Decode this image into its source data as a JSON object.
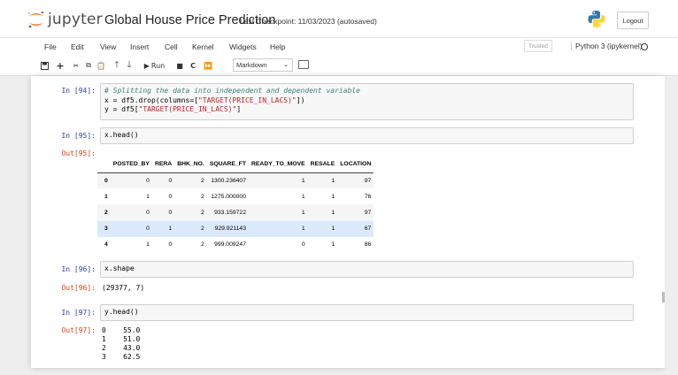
{
  "header": {
    "logo_text": "jupyter",
    "notebook_title": "Global House Price Prediction",
    "checkpoint": "Last Checkpoint: 11/03/2023  (autosaved)",
    "logout_label": "Logout"
  },
  "menubar": {
    "items": [
      "File",
      "Edit",
      "View",
      "Insert",
      "Cell",
      "Kernel",
      "Widgets",
      "Help"
    ],
    "trusted_label": "Trusted",
    "kernel_name": "Python 3 (ipykernel)"
  },
  "toolbar": {
    "run_label": "Run",
    "cell_type": "Markdown"
  },
  "cells": {
    "c94": {
      "prompt": "In [94]:",
      "comment": "# Splitting the data into independent and dependent variable",
      "line2_pre": "x = df5.drop(columns=[",
      "line2_str": "\"TARGET(PRICE_IN_LACS)\"",
      "line2_post": "])",
      "line3_pre": "y = df5[",
      "line3_str": "\"TARGET(PRICE_IN_LACS)\"",
      "line3_post": "]"
    },
    "c95": {
      "prompt": "In [95]:",
      "code": "x.head()",
      "out_prompt": "Out[95]:"
    },
    "c96": {
      "prompt": "In [96]:",
      "code": "x.shape",
      "out_prompt": "Out[96]:",
      "output": "(29377, 7)"
    },
    "c97": {
      "prompt": "In [97]:",
      "code": "y.head()",
      "out_prompt": "Out[97]:",
      "output_lines": [
        "0    55.0",
        "1    51.0",
        "2    43.0",
        "3    62.5"
      ]
    }
  },
  "dataframe": {
    "columns": [
      "",
      "POSTED_BY",
      "RERA",
      "BHK_NO.",
      "SQUARE_FT",
      "READY_TO_MOVE",
      "RESALE",
      "LOCATION"
    ],
    "rows": [
      [
        "0",
        "0",
        "0",
        "2",
        "1300.236407",
        "1",
        "1",
        "97"
      ],
      [
        "1",
        "1",
        "0",
        "2",
        "1275.000000",
        "1",
        "1",
        "76"
      ],
      [
        "2",
        "0",
        "0",
        "2",
        "933.159722",
        "1",
        "1",
        "97"
      ],
      [
        "3",
        "0",
        "1",
        "2",
        "929.921143",
        "1",
        "1",
        "67"
      ],
      [
        "4",
        "1",
        "0",
        "2",
        "999.009247",
        "0",
        "1",
        "86"
      ]
    ]
  }
}
